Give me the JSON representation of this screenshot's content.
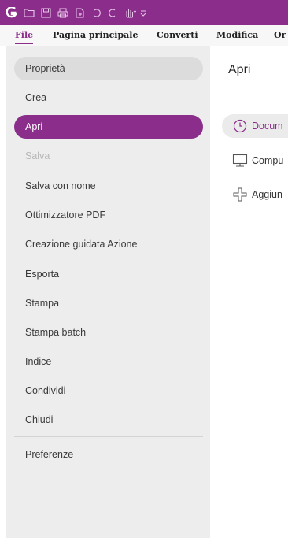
{
  "quick_access": {
    "icons": [
      "app-logo-icon",
      "open-folder-icon",
      "save-icon",
      "print-icon",
      "new-doc-icon",
      "undo-icon",
      "redo-icon",
      "hand-tool-icon",
      "customize-icon"
    ],
    "accent_color": "#8b2e8b"
  },
  "ribbon": {
    "tabs": [
      {
        "label": "File"
      },
      {
        "label": "Pagina principale"
      },
      {
        "label": "Converti"
      },
      {
        "label": "Modifica"
      },
      {
        "label": "Or"
      }
    ]
  },
  "nav": {
    "items": [
      {
        "label": "Proprietà"
      },
      {
        "label": "Crea"
      },
      {
        "label": "Apri"
      },
      {
        "label": "Salva"
      },
      {
        "label": "Salva con nome"
      },
      {
        "label": "Ottimizzatore PDF"
      },
      {
        "label": "Creazione guidata Azione"
      },
      {
        "label": "Esporta"
      },
      {
        "label": "Stampa"
      },
      {
        "label": "Stampa batch"
      },
      {
        "label": "Indice"
      },
      {
        "label": "Condividi"
      },
      {
        "label": "Chiudi"
      },
      {
        "label": "Preferenze"
      }
    ]
  },
  "content": {
    "title": "Apri",
    "locations": [
      {
        "label": "Docum",
        "icon": "clock-icon"
      },
      {
        "label": "Compu",
        "icon": "computer-icon"
      },
      {
        "label": "Aggiun",
        "icon": "add-icon"
      }
    ]
  }
}
